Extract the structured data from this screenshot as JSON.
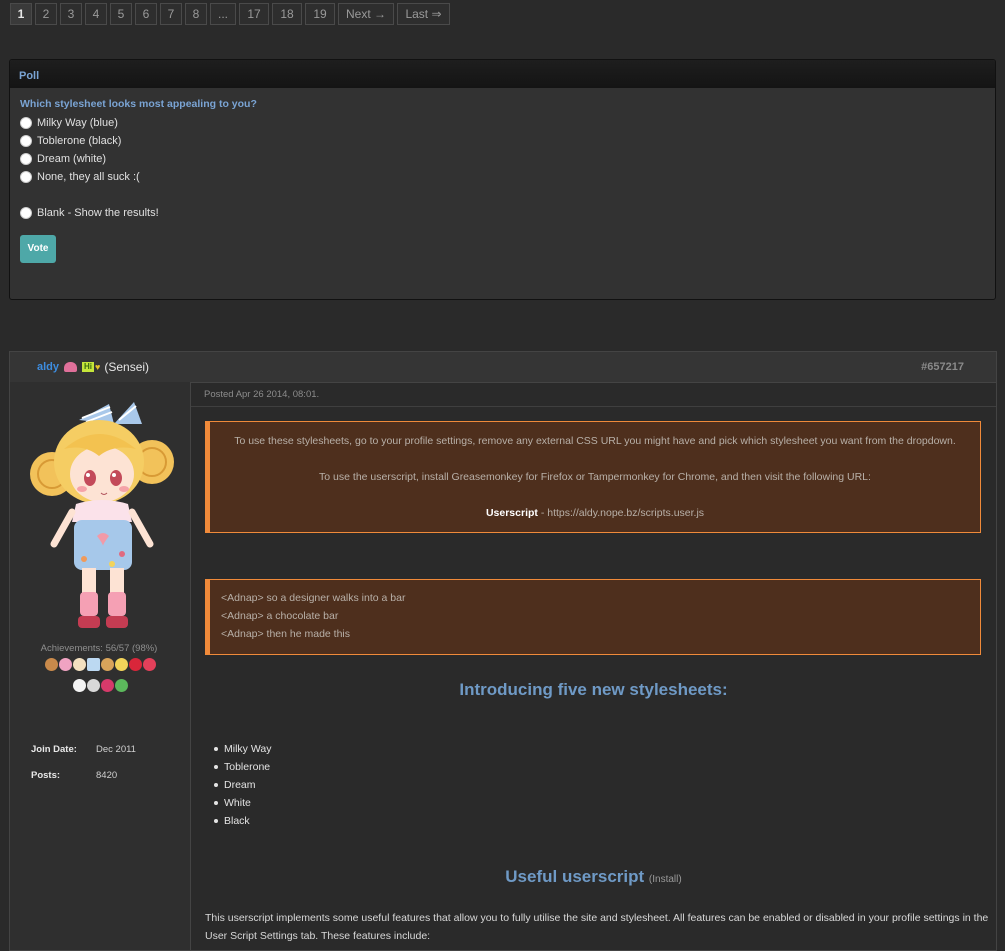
{
  "pagination": {
    "pages": [
      "1",
      "2",
      "3",
      "4",
      "5",
      "6",
      "7",
      "8",
      "...",
      "17",
      "18",
      "19"
    ],
    "current": "1",
    "next_label": "Next →",
    "last_label": "Last ⇒"
  },
  "poll": {
    "title": "Poll",
    "question": "Which stylesheet looks most appealing to you?",
    "options": [
      "Milky Way (blue)",
      "Toblerone (black)",
      "Dream (white)",
      "None, they all suck :(",
      "Blank - Show the results!"
    ],
    "vote_label": "Vote"
  },
  "post": {
    "username": "aldy",
    "badge_text": "Hi",
    "rank": "(Sensei)",
    "post_number": "#657217",
    "posted": "Posted Apr 26 2014, 08:01.",
    "achievements": "Achievements: 56/57 (98%)",
    "join_label": "Join Date:",
    "join_value": "Dec 2011",
    "posts_label": "Posts:",
    "posts_value": "8420",
    "notice1": {
      "line1": "To use these stylesheets, go to your profile settings, remove any external CSS URL you might have and pick which stylesheet you want from the dropdown.",
      "line2": "To use the userscript, install Greasemonkey for Firefox or Tampermonkey for Chrome, and then visit the following URL:",
      "url_label": "Userscript",
      "url_value": " - https://aldy.nope.bz/scripts.user.js"
    },
    "quote": [
      "<Adnap> so a designer walks into a bar",
      "<Adnap> a chocolate bar",
      "<Adnap> then he made this"
    ],
    "heading1": "Introducing five new stylesheets:",
    "stylesheets": [
      "Milky Way",
      "Toblerone",
      "Dream",
      "White",
      "Black"
    ],
    "heading2": "Useful userscript",
    "heading2_link": "(Install)",
    "paragraph": "This userscript implements some useful features that allow you to fully utilise the site and stylesheet. All features can be enabled or disabled in your profile settings in the User Script Settings tab. These features include:"
  },
  "colors": {
    "accent_blue": "#6f9ac6",
    "vote_teal": "#4ea8a8",
    "notice_bg": "#4e2f1d",
    "notice_border": "#f08a3a"
  }
}
